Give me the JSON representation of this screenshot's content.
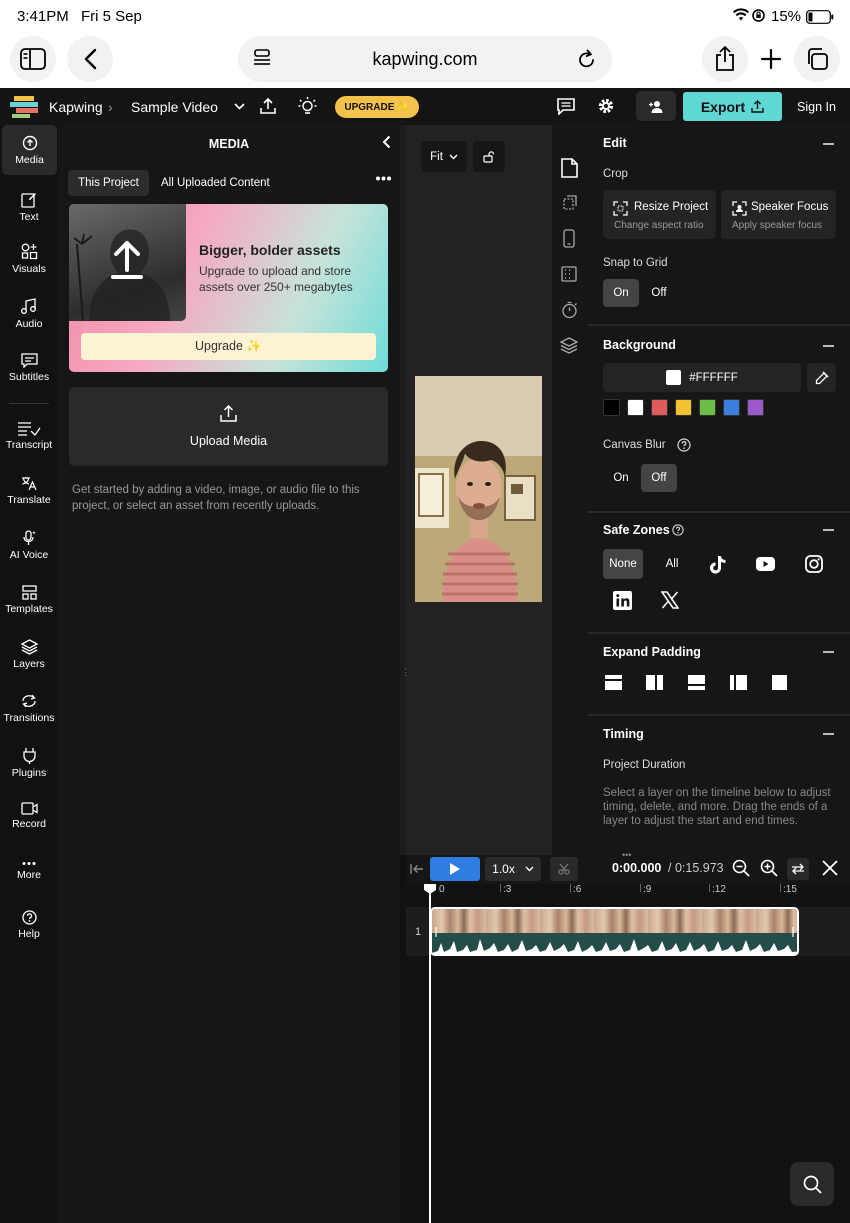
{
  "status": {
    "time": "3:41PM",
    "date": "Fri 5 Sep",
    "battery": "15%"
  },
  "browser": {
    "url": "kapwing.com"
  },
  "header": {
    "app_name": "Kapwing",
    "project_name": "Sample Video",
    "upgrade_label": "UPGRADE ✨",
    "export_label": "Export",
    "signin_label": "Sign In"
  },
  "rail": {
    "media": "Media",
    "text": "Text",
    "visuals": "Visuals",
    "audio": "Audio",
    "subtitles": "Subtitles",
    "transcript": "Transcript",
    "translate": "Translate",
    "ai_voice": "AI Voice",
    "templates": "Templates",
    "layers": "Layers",
    "transitions": "Transitions",
    "plugins": "Plugins",
    "record": "Record",
    "more": "More",
    "help": "Help"
  },
  "media": {
    "title": "MEDIA",
    "tab_project": "This Project",
    "tab_uploaded": "All Uploaded Content",
    "promo_title": "Bigger, bolder assets",
    "promo_text": "Upgrade to upload and store assets over 250+ megabytes",
    "promo_button": "Upgrade ✨",
    "upload_label": "Upload Media",
    "hint": "Get started by adding a video, image, or audio file to this project, or select an asset from recently uploads."
  },
  "canvas": {
    "fit_label": "Fit"
  },
  "edit": {
    "title": "Edit",
    "crop_label": "Crop",
    "resize_title": "Resize Project",
    "resize_sub": "Change aspect ratio",
    "focus_title": "Speaker Focus",
    "focus_sub": "Apply speaker focus",
    "snap_label": "Snap to Grid",
    "on": "On",
    "off": "Off"
  },
  "background": {
    "title": "Background",
    "color_value": "#FFFFFF",
    "swatches": [
      "#000000",
      "#ffffff",
      "#e05b5b",
      "#f2c233",
      "#6bbf47",
      "#3a7fdc",
      "#9b59c9"
    ],
    "blur_label": "Canvas Blur",
    "on": "On",
    "off": "Off"
  },
  "safe_zones": {
    "title": "Safe Zones",
    "none": "None",
    "all": "All"
  },
  "expand_padding": {
    "title": "Expand Padding"
  },
  "timing": {
    "title": "Timing",
    "duration_label": "Project Duration",
    "hint": "Select a layer on the timeline below to adjust timing, delete, and more. Drag the ends of a layer to adjust the start and end times."
  },
  "timeline": {
    "speed": "1.0x",
    "current_time": "0:00.000",
    "total_time": "/ 0:15.973",
    "ticks": [
      "0",
      ":3",
      ":6",
      ":9",
      ":12",
      ":15"
    ],
    "track_number": "1"
  },
  "colors": {
    "accent_teal": "#5fd7d4",
    "upgrade_yellow": "#f3c24a",
    "play_blue": "#2f7de1"
  }
}
